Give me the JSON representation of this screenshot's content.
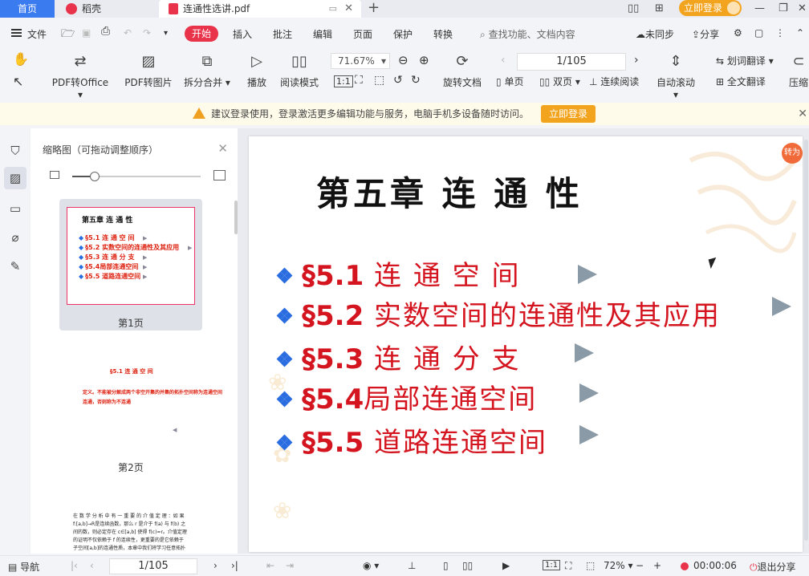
{
  "tabs": {
    "home": "首页",
    "daoke": "稻壳",
    "document": "连通性选讲.pdf",
    "add": "+",
    "login": "立即登录"
  },
  "menu": {
    "file": "文件",
    "start": "开始",
    "items": [
      "插入",
      "批注",
      "编辑",
      "页面",
      "保护",
      "转换"
    ],
    "search_placeholder": "查找功能、文档内容",
    "sync": "未同步",
    "share": "分享"
  },
  "toolbar": {
    "pdf_to_office": "PDF转Office",
    "pdf_to_image": "PDF转图片",
    "split_merge": "拆分合并",
    "play": "播放",
    "read_mode": "阅读模式",
    "zoom": "71.67%",
    "page_display": "1/105",
    "rotate_doc": "旋转文档",
    "single_page": "单页",
    "double_page": "双页",
    "continuous": "连续阅读",
    "auto_scroll": "自动滚动",
    "word_translate": "划词翻译",
    "full_translate": "全文翻译",
    "compress": "压缩"
  },
  "notice": {
    "text": "建议登录使用，登录激活更多编辑功能与服务，电脑手机多设备随时访问。",
    "button": "立即登录"
  },
  "thumbnail_panel": {
    "title": "缩略图（可拖动调整顺序）",
    "page1_label": "第1页",
    "page2_label": "第2页",
    "page1_title": "第五章  连 通 性",
    "page1_lines": [
      "§5.1 连 通 空 间",
      "§5.2 实数空间的连通性及其应用",
      "§5.3  连 通 分 支",
      "§5.4局部连通空间",
      "§5.5 道路连通空间"
    ],
    "page2_title": "§5.1 连 通 空 间",
    "page2_lines": [
      "定义。不能被分解成两个非空开集的并集的拓扑空间称为连通空间",
      "连通，否则称为不连通"
    ],
    "page3_lines": [
      "在 数 学 分 析 中 有 一 重 要 的 介 值 定 理 ：如 果",
      "f:[a,b]→R是连续函数，那么 r 是介于 f(a) 与 f(b) 之",
      "间的数，则必定存在 c∈[a,b] 使得 f(c)=r。介值定理",
      "的证明不仅依赖于 f 的连续性，更重要的是它依赖于",
      "子空间[a,b]的连通性质，本章中我们将学习任意拓扑"
    ]
  },
  "page": {
    "title": "第五章  连  通  性",
    "items": [
      {
        "sec": "§5.1",
        "text": " 连 通 空 间"
      },
      {
        "sec": "§5.2",
        "text": " 实数空间的连通性及其应用"
      },
      {
        "sec": "§5.3",
        "text": "  连 通 分 支"
      },
      {
        "sec": "§5.4",
        "text": "局部连通空间"
      },
      {
        "sec": "§5.5",
        "text": " 道路连通空间"
      }
    ],
    "convert_badge": "转为"
  },
  "statusbar": {
    "nav": "导航",
    "page": "1/105",
    "zoom": "72%",
    "timer": "00:00:06",
    "exit_share": "退出分享"
  },
  "colors": {
    "accent": "#3a7bf0",
    "brand_red": "#e8334a",
    "login_orange": "#f3a41f",
    "title_red": "#d4141e"
  }
}
